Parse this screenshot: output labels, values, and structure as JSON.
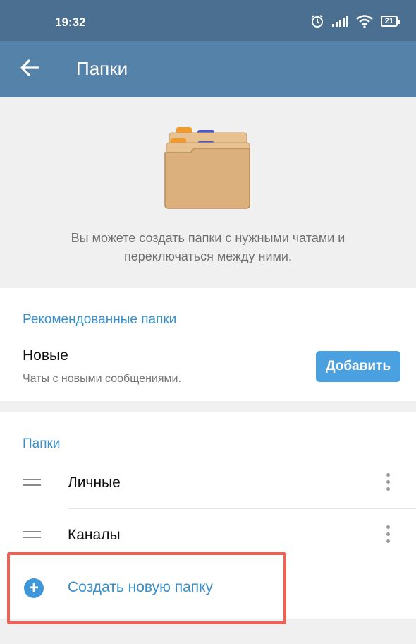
{
  "status_bar": {
    "time": "19:32",
    "battery": "21"
  },
  "app_bar": {
    "title": "Папки"
  },
  "hero": {
    "description": "Вы можете создать папки с нужными чатами и переключаться между ними."
  },
  "recommended": {
    "title": "Рекомендованные папки",
    "item": {
      "name": "Новые",
      "description": "Чаты с новыми сообщениями.",
      "button_label": "Добавить"
    }
  },
  "folders": {
    "title": "Папки",
    "items": [
      {
        "label": "Личные"
      },
      {
        "label": "Каналы"
      }
    ],
    "create_label": "Создать новую папку"
  },
  "colors": {
    "app_bar": "#5582a8",
    "status_bar": "#4a6f91",
    "accent": "#3a8fc9",
    "button": "#4ba1e0",
    "highlight": "#e8635a"
  },
  "icons": [
    "back-arrow-icon",
    "alarm-icon",
    "signal-icon",
    "wifi-icon",
    "battery-icon",
    "folder-illustration",
    "drag-handle-icon",
    "more-vert-icon",
    "plus-circle-icon"
  ]
}
